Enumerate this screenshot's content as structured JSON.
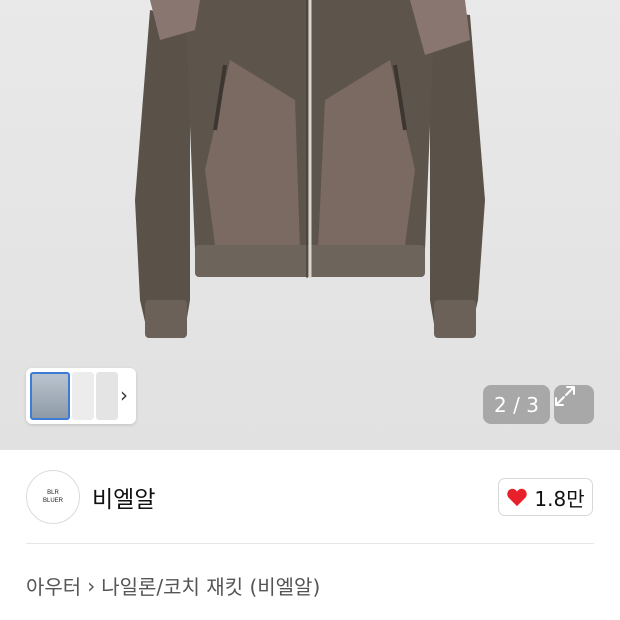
{
  "gallery": {
    "counter": "2 / 3",
    "expand_icon": "expand-arrows-icon",
    "thumbnails_chevron": "›"
  },
  "seller": {
    "logo_line1": "BLR",
    "logo_line2": "BLUER",
    "name": "비엘알",
    "like_icon": "heart-icon",
    "like_color": "#e8202a",
    "like_count": "1.8만"
  },
  "breadcrumb": {
    "category": "아우터",
    "separator": "›",
    "subcategory": "나일론/코치 재킷 (비엘알)"
  }
}
